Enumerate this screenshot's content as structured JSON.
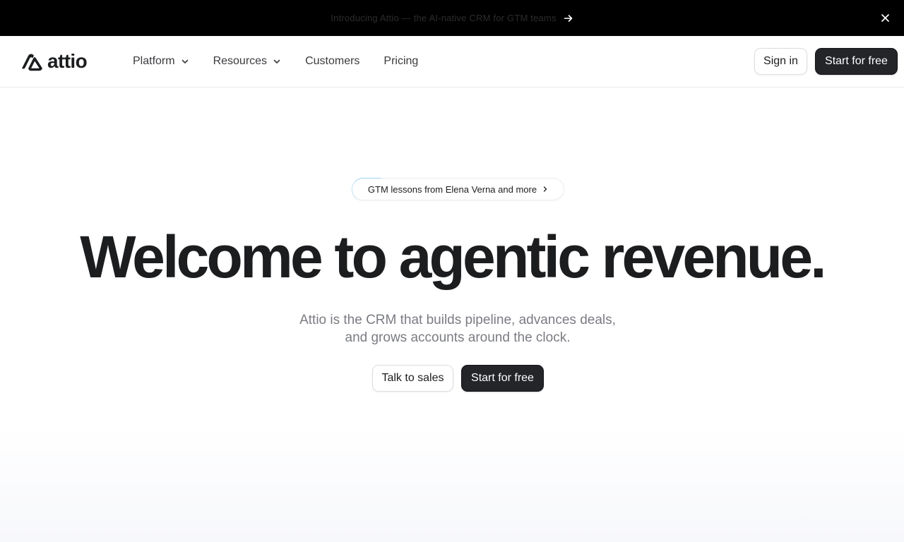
{
  "announcement": {
    "text": "Introducing Attio — the AI-native CRM for GTM teams"
  },
  "header": {
    "logo_text": "attio",
    "nav": [
      {
        "label": "Platform",
        "has_dropdown": true
      },
      {
        "label": "Resources",
        "has_dropdown": true
      },
      {
        "label": "Customers",
        "has_dropdown": false
      },
      {
        "label": "Pricing",
        "has_dropdown": false
      }
    ],
    "signin_label": "Sign in",
    "start_label": "Start for free"
  },
  "hero": {
    "pill_text": "GTM lessons from Elena Verna and more",
    "title": "Welcome to agentic revenue.",
    "subtitle": "Attio is the CRM that builds pipeline, advances deals, and grows accounts around the clock.",
    "talk_label": "Talk to sales",
    "start_label": "Start for free"
  },
  "icons": {
    "announcement_arrow": "arrow-right-icon",
    "close": "close-icon",
    "nav_chevron": "chevron-down-icon",
    "pill_chevron": "chevron-right-icon",
    "logo": "attio-logo-mark"
  },
  "colors": {
    "announcement_bg": "#000000",
    "primary_button": "#232529",
    "subtitle_text": "#7a7c82",
    "heading_text": "#1c1d1f"
  }
}
